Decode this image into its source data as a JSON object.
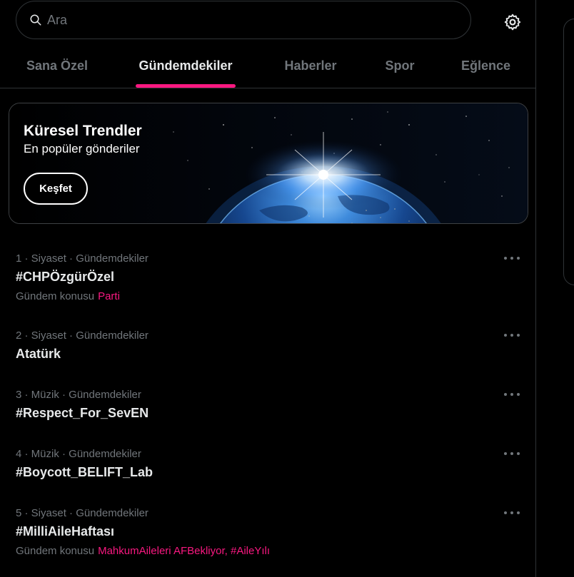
{
  "search": {
    "placeholder": "Ara",
    "value": ""
  },
  "icons": {
    "search": "search-icon",
    "settings": "gear-icon",
    "more": "more-horizontal-icon"
  },
  "colors": {
    "accent": "#f91880",
    "background": "#000000",
    "muted": "#71767b",
    "text": "#e7e9ea",
    "border": "#2f3336"
  },
  "tabs": [
    {
      "label": "Sana Özel",
      "active": false
    },
    {
      "label": "Gündemdekiler",
      "active": true
    },
    {
      "label": "Haberler",
      "active": false
    },
    {
      "label": "Spor",
      "active": false
    },
    {
      "label": "Eğlence",
      "active": false
    }
  ],
  "banner": {
    "title": "Küresel Trendler",
    "subtitle": "En popüler gönderiler",
    "button": "Keşfet"
  },
  "trends": [
    {
      "meta": "1 · Siyaset · Gündemdekiler",
      "name": "#CHPÖzgürÖzel",
      "foot_label": "Gündem konusu",
      "foot_link": "Parti"
    },
    {
      "meta": "2 · Siyaset · Gündemdekiler",
      "name": "Atatürk"
    },
    {
      "meta": "3 · Müzik · Gündemdekiler",
      "name": "#Respect_For_SevEN"
    },
    {
      "meta": "4 · Müzik · Gündemdekiler",
      "name": "#Boycott_BELIFT_Lab"
    },
    {
      "meta": "5 · Siyaset · Gündemdekiler",
      "name": "#MilliAileHaftası",
      "foot_label": "Gündem konusu",
      "foot_link": "MahkumAileleri AFBekliyor, #AileYılı"
    }
  ]
}
